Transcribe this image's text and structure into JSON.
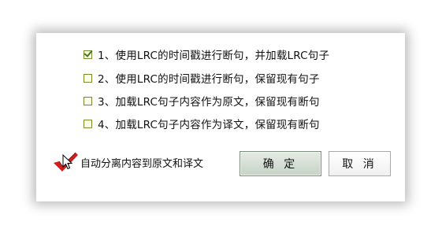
{
  "options": [
    {
      "label": "1、使用LRC的时间戳进行断句，并加载LRC句子",
      "checked": true
    },
    {
      "label": "2、使用LRC的时间戳进行断句，保留现有句子",
      "checked": false
    },
    {
      "label": "3、加载LRC句子内容作为原文，保留现有断句",
      "checked": false
    },
    {
      "label": "4、加载LRC句子内容作为译文，保留现有断句",
      "checked": false
    }
  ],
  "auto_split": {
    "label": "自动分离内容到原文和译文",
    "checked": true
  },
  "buttons": {
    "ok_label": "确 定",
    "cancel_label": "取 消"
  },
  "colors": {
    "check_red": "#cc1f1f",
    "checkbox_green": "#3d7a1e",
    "ok_button": "#c7d3c7"
  },
  "icons": {
    "auto_check": "red-check-mark-icon",
    "cursor": "mouse-pointer-icon"
  }
}
